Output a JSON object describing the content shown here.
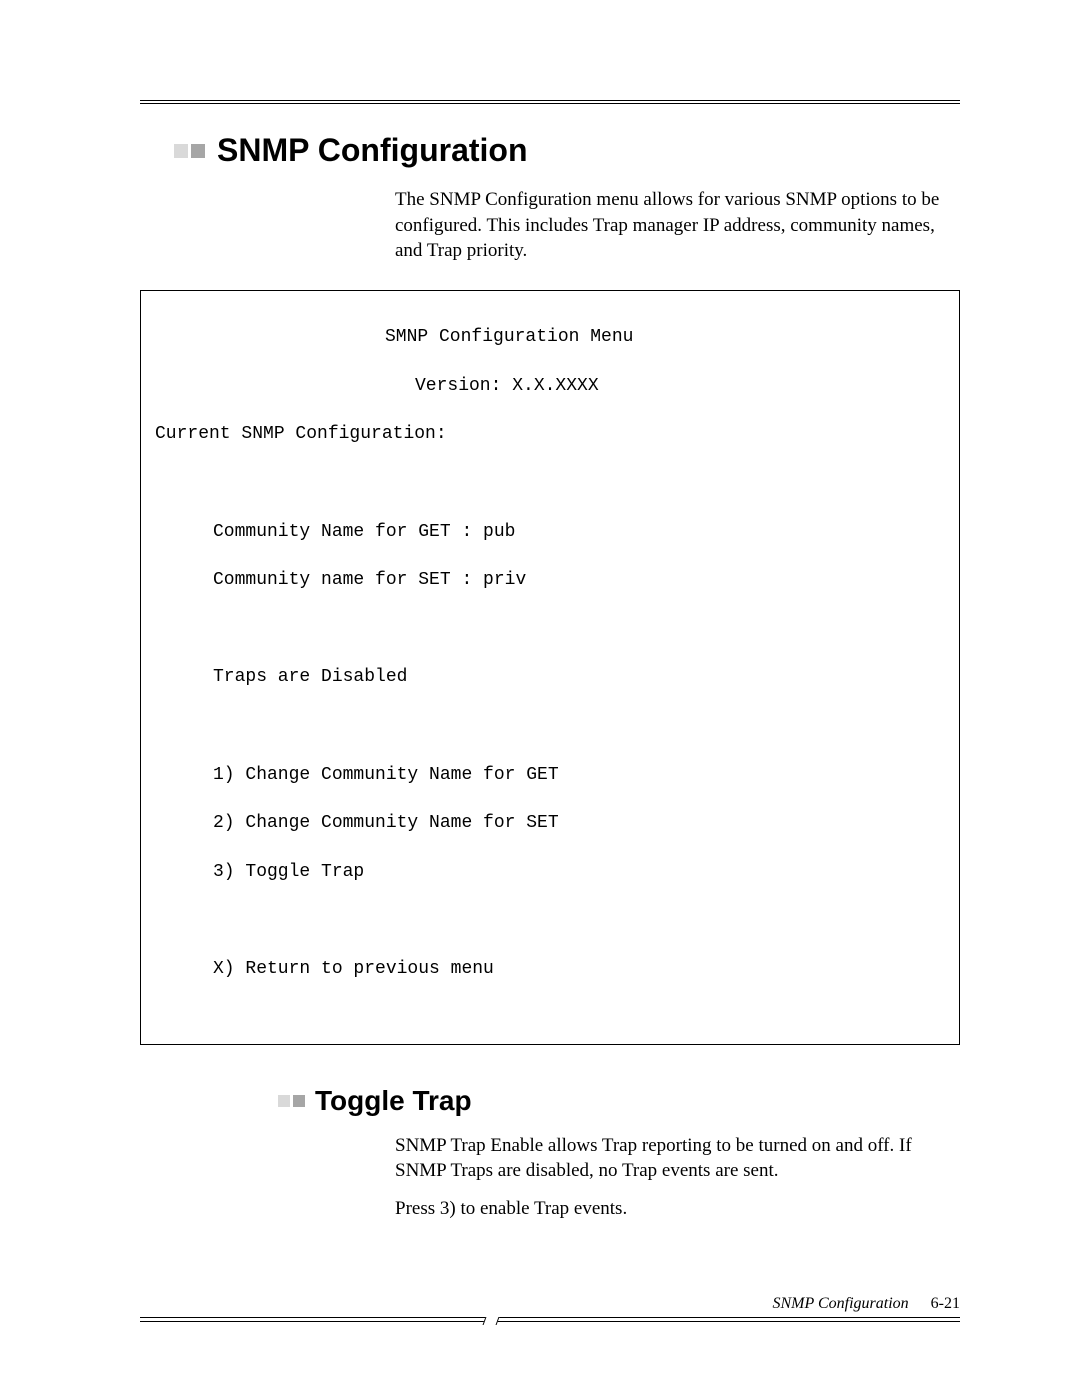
{
  "section1": {
    "title": "SNMP Configuration",
    "paragraph": "The SNMP Configuration menu allows for various SNMP options to be configured. This includes Trap manager IP address, community names, and Trap priority."
  },
  "codebox": {
    "title": "SMNP Configuration Menu",
    "version": "Version: X.X.XXXX",
    "current": "Current SNMP Configuration:",
    "getline": "Community Name for GET : pub",
    "setline": "Community name for SET : priv",
    "traps": "Traps are Disabled",
    "opt1": "1) Change Community Name for GET",
    "opt2": "2) Change Community Name for SET",
    "opt3": "3) Toggle Trap",
    "optx": "X) Return to previous menu"
  },
  "section2": {
    "title": "Toggle Trap",
    "p1": "SNMP Trap Enable allows Trap reporting to be turned on and off. If SNMP Traps are disabled, no Trap events are sent.",
    "p2": "Press 3) to enable Trap events."
  },
  "footer": {
    "label": "SNMP Configuration",
    "page": "6-21"
  }
}
